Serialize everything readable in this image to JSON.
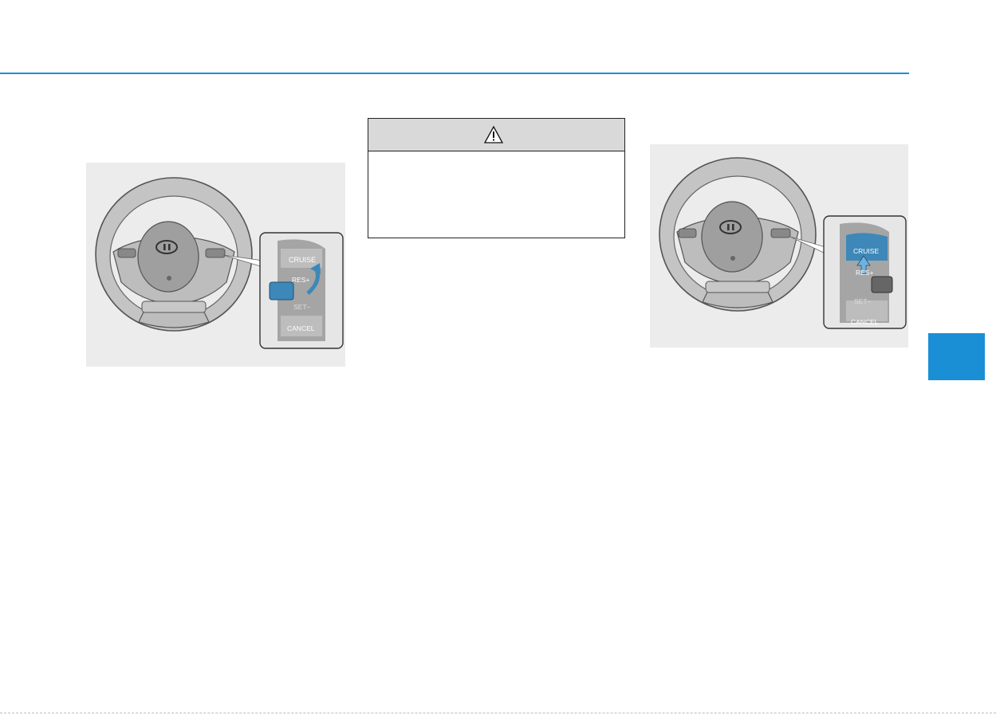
{
  "figures": {
    "left": {
      "callout": {
        "cruise_label": "CRUISE",
        "res_label": "RES+",
        "set_label": "SET−",
        "cancel_label": "CANCEL"
      }
    },
    "right": {
      "callout": {
        "cruise_label": "CRUISE",
        "res_label": "RES+",
        "set_label": "SET−",
        "cancel_label": "CANCEL"
      }
    }
  },
  "warning": {
    "icon": "warning-triangle-icon"
  },
  "colors": {
    "accent": "#1a8fd6",
    "highlight": "#3d88b8",
    "figure_bg": "#ececec",
    "warning_header": "#d9d9d9"
  }
}
